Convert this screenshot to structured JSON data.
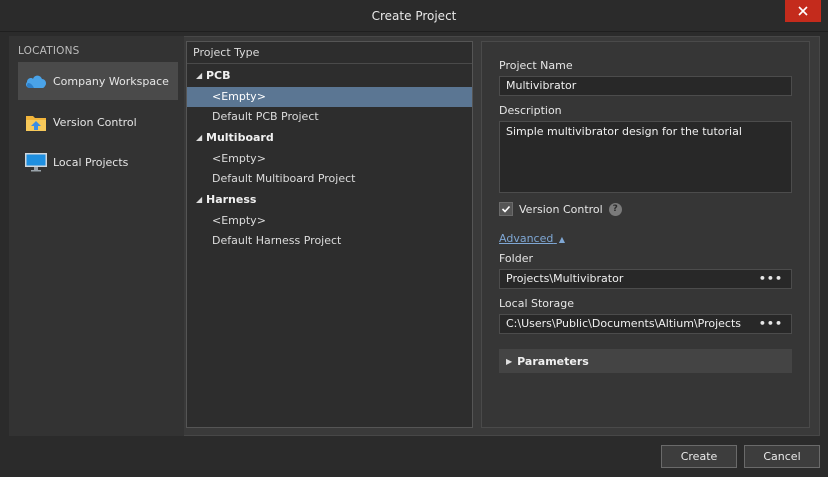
{
  "window": {
    "title": "Create Project"
  },
  "locations": {
    "header": "LOCATIONS",
    "items": [
      {
        "label": "Company Workspace",
        "icon": "cloud-icon"
      },
      {
        "label": "Version Control",
        "icon": "folder-upload-icon"
      },
      {
        "label": "Local Projects",
        "icon": "monitor-icon"
      }
    ]
  },
  "project_type": {
    "header": "Project Type",
    "groups": [
      {
        "label": "PCB",
        "children": [
          "<Empty>",
          "Default PCB Project"
        ]
      },
      {
        "label": "Multiboard",
        "children": [
          "<Empty>",
          "Default Multiboard Project"
        ]
      },
      {
        "label": "Harness",
        "children": [
          "<Empty>",
          "Default Harness Project"
        ]
      }
    ],
    "selected": "PCB / <Empty>"
  },
  "properties": {
    "project_name_label": "Project Name",
    "project_name_value": "Multivibrator",
    "description_label": "Description",
    "description_value": "Simple multivibrator design for the tutorial",
    "version_control_label": "Version Control",
    "version_control_checked": true,
    "advanced_label": "Advanced",
    "folder_label": "Folder",
    "folder_value": "Projects\\Multivibrator",
    "local_storage_label": "Local Storage",
    "local_storage_value": "C:\\Users\\Public\\Documents\\Altium\\Projects",
    "parameters_label": "Parameters",
    "browse_dots": "•••"
  },
  "buttons": {
    "create": "Create",
    "cancel": "Cancel"
  },
  "colors": {
    "accent_selection": "#5b7693",
    "close_button": "#c42b1c",
    "link": "#7fa7d4"
  }
}
